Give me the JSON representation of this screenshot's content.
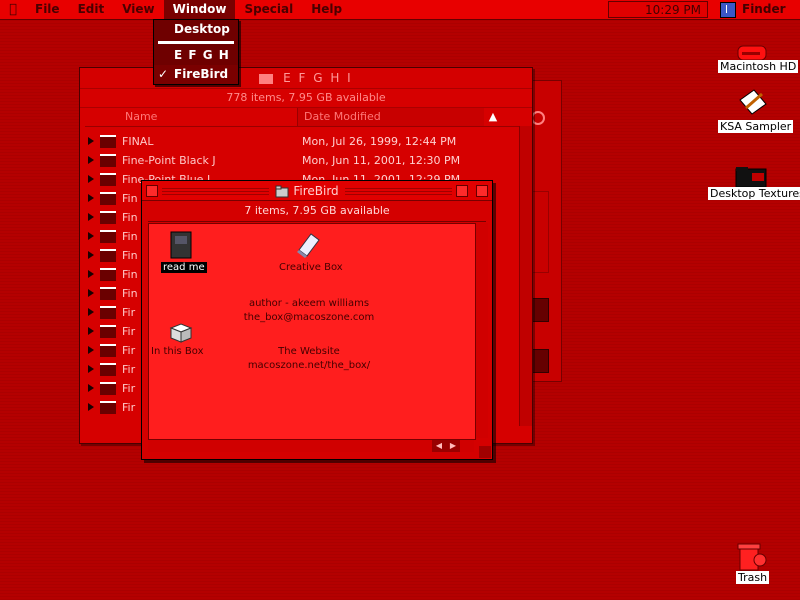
{
  "menubar": {
    "items": [
      "File",
      "Edit",
      "View",
      "Window",
      "Special",
      "Help"
    ],
    "active": "Window",
    "clock": "10:29 PM",
    "app": "Finder"
  },
  "window_menu": {
    "items": [
      "Desktop",
      "E F G H I",
      "FireBird"
    ],
    "checked": "FireBird"
  },
  "back_window": {
    "title": "E F G H I",
    "info": "778 items, 7.95 GB available",
    "col_name": "Name",
    "col_date": "Date Modified",
    "rows": [
      {
        "name": "FINAL",
        "date": "Mon, Jul 26, 1999, 12:44 PM"
      },
      {
        "name": "Fine-Point Black J",
        "date": "Mon, Jun 11, 2001, 12:30 PM"
      },
      {
        "name": "Fine-Point Blue J",
        "date": "Mon, Jun 11, 2001, 12:29 PM"
      },
      {
        "name": "Fin",
        "date": ""
      },
      {
        "name": "Fin",
        "date": ""
      },
      {
        "name": "Fin",
        "date": ""
      },
      {
        "name": "Fin",
        "date": ""
      },
      {
        "name": "Fin",
        "date": ""
      },
      {
        "name": "Fin",
        "date": ""
      },
      {
        "name": "Fir",
        "date": ""
      },
      {
        "name": "Fir",
        "date": ""
      },
      {
        "name": "Fir",
        "date": ""
      },
      {
        "name": "Fir",
        "date": ""
      },
      {
        "name": "Fir",
        "date": ""
      },
      {
        "name": "Fir",
        "date": ""
      }
    ]
  },
  "front_window": {
    "title": "FireBird",
    "info": "7 items, 7.95 GB available",
    "icons": {
      "read_me": "read me",
      "creative_box": "Creative Box",
      "in_this_box": "In this Box"
    },
    "author_line1": "author - akeem williams",
    "author_line2": "the_box@macoszone.com",
    "website_line1": "The Website",
    "website_line2": "macoszone.net/the_box/"
  },
  "desktop": {
    "icons": [
      "Macintosh HD",
      "KSA Sampler",
      "Desktop Textures",
      "Trash"
    ]
  }
}
